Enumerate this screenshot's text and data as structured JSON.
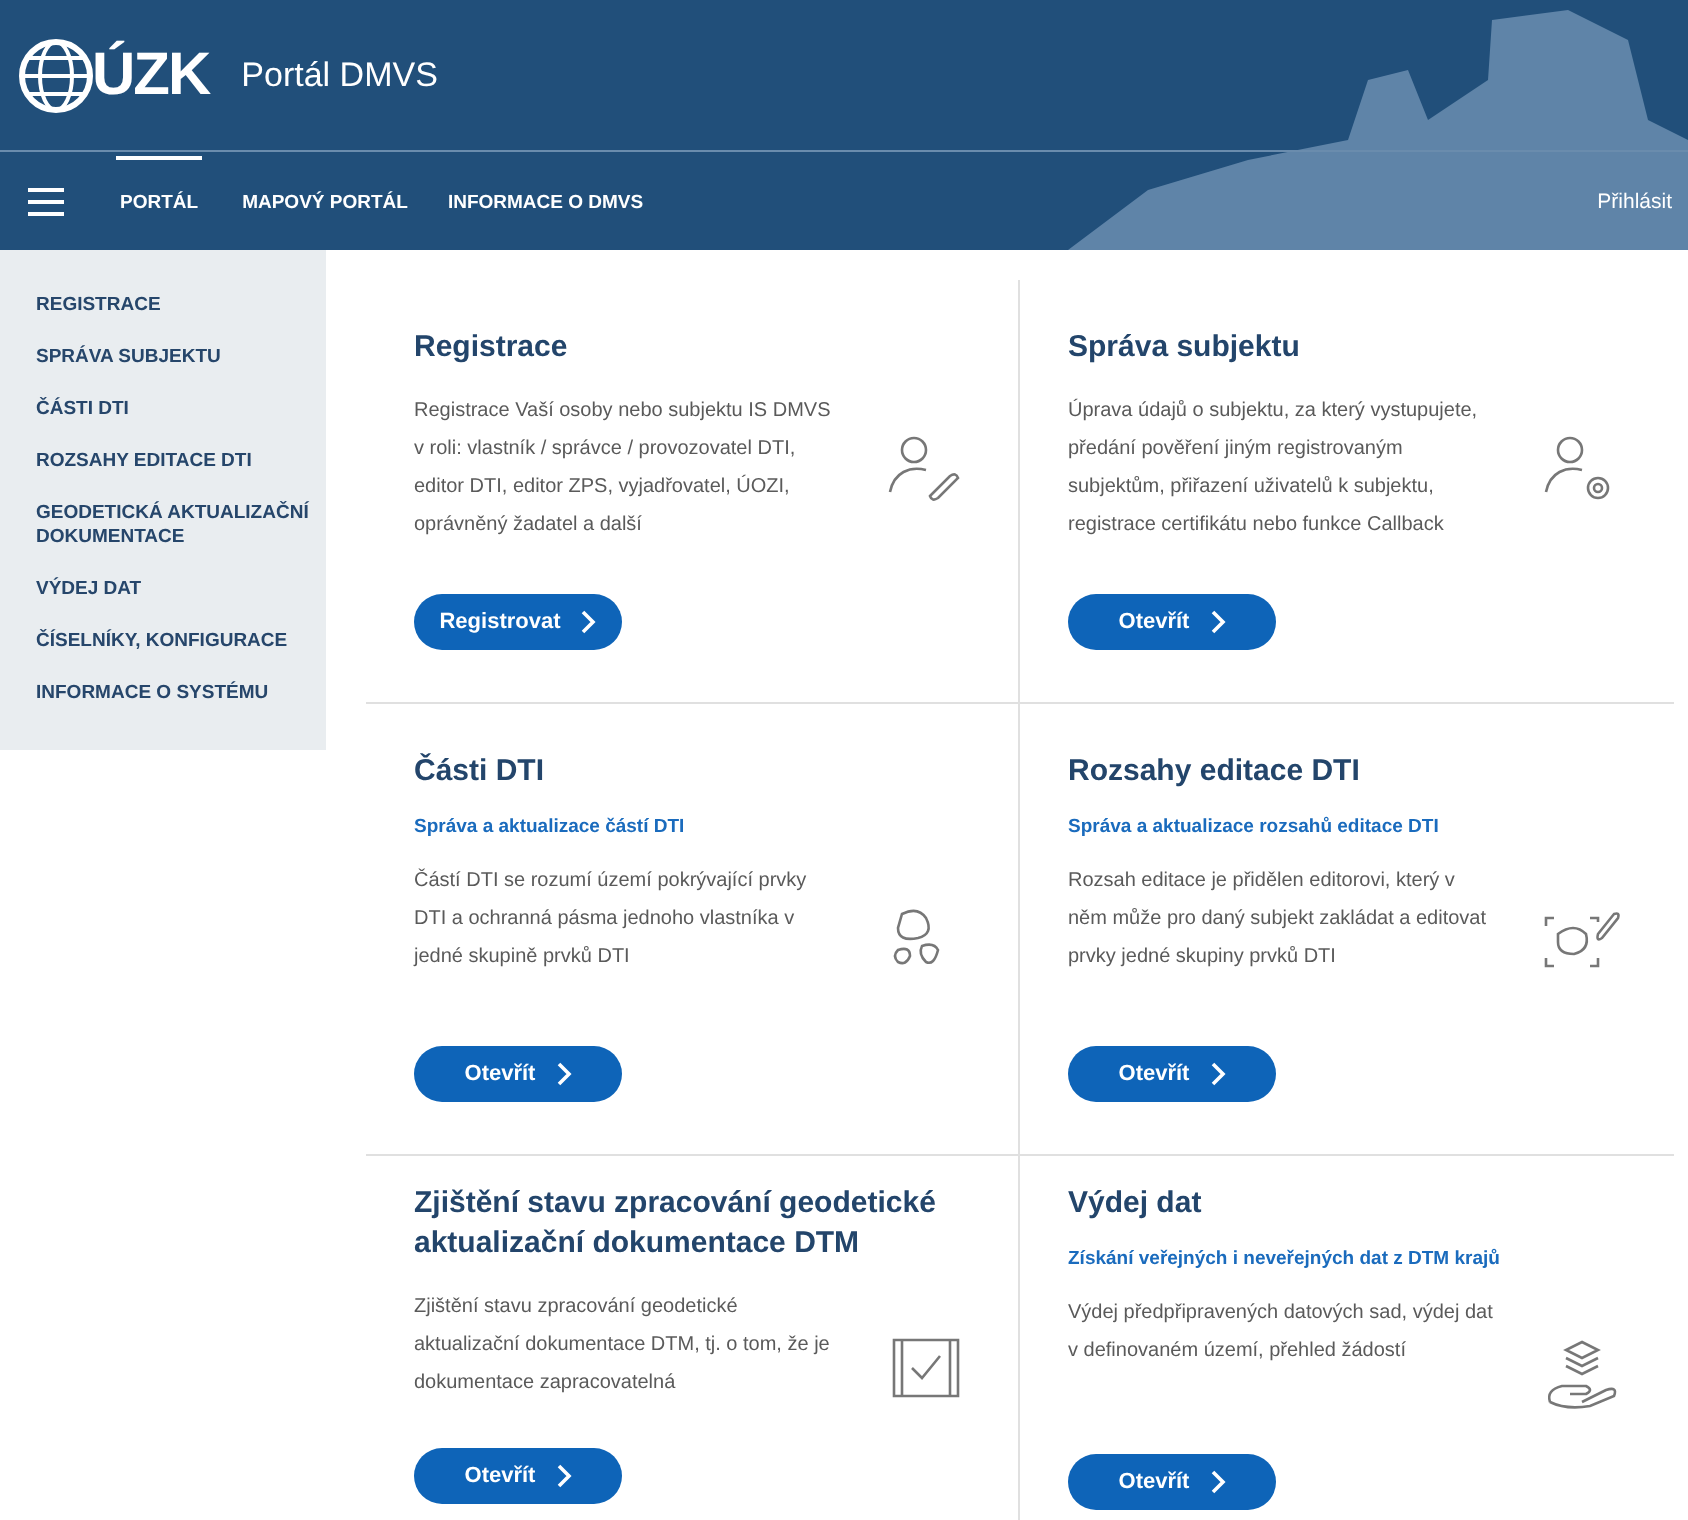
{
  "header": {
    "logo_text": "ÚZK",
    "title": "Portál DMVS"
  },
  "nav": {
    "items": [
      {
        "label": "PORTÁL",
        "selected": true
      },
      {
        "label": "MAPOVÝ PORTÁL",
        "selected": false
      },
      {
        "label": "INFORMACE O DMVS",
        "selected": false
      }
    ],
    "login": "Přihlásit"
  },
  "sidebar": {
    "items": [
      "REGISTRACE",
      "SPRÁVA SUBJEKTU",
      "ČÁSTI DTI",
      "ROZSAHY EDITACE DTI",
      "GEODETICKÁ AKTUALIZAČNÍ DOKUMENTACE",
      "VÝDEJ DAT",
      "ČÍSELNÍKY, KONFIGURACE",
      "INFORMACE O SYSTÉMU"
    ]
  },
  "cards": [
    {
      "title": "Registrace",
      "text": "Registrace Vaší osoby nebo subjektu IS DMVS v roli: vlastník / správce / provozovatel DTI, editor DTI, editor ZPS, vyjadřovatel, ÚOZI, oprávněný žadatel a další",
      "button": "Registrovat",
      "kind": "person-pen"
    },
    {
      "title": "Správa subjektu",
      "text": "Úprava údajů o subjektu, za který vystupujete, předání pověření jiným registrovaným subjektům, přiřazení uživatelů k subjektu, registrace certifikátu nebo funkce Callback",
      "button": "Otevřít",
      "kind": "person-gear"
    },
    {
      "title": "Části DTI",
      "subtitle": "Správa a aktualizace částí DTI",
      "text": "Částí DTI se rozumí území pokrývající prvky DTI a ochranná pásma jednoho vlastníka v jedné skupině prvků DTI",
      "button": "Otevřít",
      "kind": "blobs"
    },
    {
      "title": "Rozsahy editace DTI",
      "subtitle": "Správa a aktualizace rozsahů editace DTI",
      "text": "Rozsah editace je přidělen editorovi, který v něm může pro daný subjekt zakládat a editovat prvky jedné skupiny prvků DTI",
      "button": "Otevřít",
      "kind": "blob-frame-pen"
    },
    {
      "title": "Zjištění stavu zpracování geodetické aktualizační dokumentace DTM",
      "text": "Zjištění stavu zpracování geodetické aktualizační dokumentace DTM, tj. o tom, že je dokumentace zapracovatelná",
      "button": "Otevřít",
      "kind": "map-check"
    },
    {
      "title": "Výdej dat",
      "subtitle": "Získání veřejných i neveřejných dat z DTM krajů",
      "text": "Výdej předpřipravených datových sad, výdej dat v definovaném území, přehled žádostí",
      "button": "Otevřít",
      "kind": "hand-layers"
    }
  ]
}
